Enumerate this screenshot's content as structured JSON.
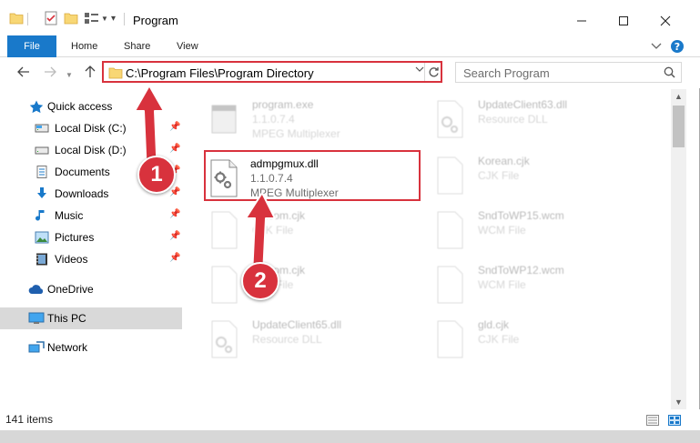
{
  "window": {
    "title": "Program"
  },
  "ribbon": {
    "tabs": [
      "File",
      "Home",
      "Share",
      "View"
    ]
  },
  "navigation": {
    "address_path": "C:\\Program Files\\Program Directory",
    "search_placeholder": "Search Program"
  },
  "sidebar": {
    "items": [
      {
        "label": "Quick access",
        "icon": "star-icon",
        "pinned": false
      },
      {
        "label": "Local Disk (C:)",
        "icon": "drive-icon",
        "pinned": true
      },
      {
        "label": "Local Disk (D:)",
        "icon": "drive-icon",
        "pinned": true
      },
      {
        "label": "Documents",
        "icon": "documents-icon",
        "pinned": true
      },
      {
        "label": "Downloads",
        "icon": "download-icon",
        "pinned": true
      },
      {
        "label": "Music",
        "icon": "music-icon",
        "pinned": true
      },
      {
        "label": "Pictures",
        "icon": "pictures-icon",
        "pinned": true
      },
      {
        "label": "Videos",
        "icon": "videos-icon",
        "pinned": true
      },
      {
        "label": "OneDrive",
        "icon": "cloud-icon",
        "pinned": false
      },
      {
        "label": "This PC",
        "icon": "computer-icon",
        "pinned": false,
        "selected": true
      },
      {
        "label": "Network",
        "icon": "network-icon",
        "pinned": false
      }
    ]
  },
  "files": [
    {
      "name": "program.exe",
      "line2": "1.1.0.7.4",
      "line3": "MPEG Multiplexer",
      "icon": "exe-icon",
      "faded": true
    },
    {
      "name": "UpdateClient63.dll",
      "line2": "Resource DLL",
      "line3": "",
      "icon": "dll-icon",
      "faded": true
    },
    {
      "name": "admpgmux.dll",
      "line2": "1.1.0.7.4",
      "line3": "MPEG Multiplexer",
      "icon": "dll-icon",
      "faded": false,
      "highlighted": true
    },
    {
      "name": "Korean.cjk",
      "line2": "CJK File",
      "line3": "",
      "icon": "file-icon",
      "faded": true
    },
    {
      "name": "Fatcom.cjk",
      "line2": "CJK File",
      "line3": "",
      "icon": "file-icon",
      "faded": true
    },
    {
      "name": "SndToWP15.wcm",
      "line2": "WCM File",
      "line3": "",
      "icon": "file-icon",
      "faded": true
    },
    {
      "name": "Fatcom.cjk",
      "line2": "CJK File",
      "line3": "",
      "icon": "file-icon",
      "faded": true
    },
    {
      "name": "SndToWP12.wcm",
      "line2": "WCM File",
      "line3": "",
      "icon": "file-icon",
      "faded": true
    },
    {
      "name": "UpdateClient65.dll",
      "line2": "Resource DLL",
      "line3": "",
      "icon": "dll-icon",
      "faded": true
    },
    {
      "name": "gld.cjk",
      "line2": "CJK File",
      "line3": "",
      "icon": "file-icon",
      "faded": true
    }
  ],
  "status": {
    "item_count": "141 items"
  },
  "annotations": {
    "step1": "1",
    "step2": "2",
    "color": "#d8323d"
  },
  "colors": {
    "accent": "#1979ca",
    "highlight": "#d8323d"
  }
}
